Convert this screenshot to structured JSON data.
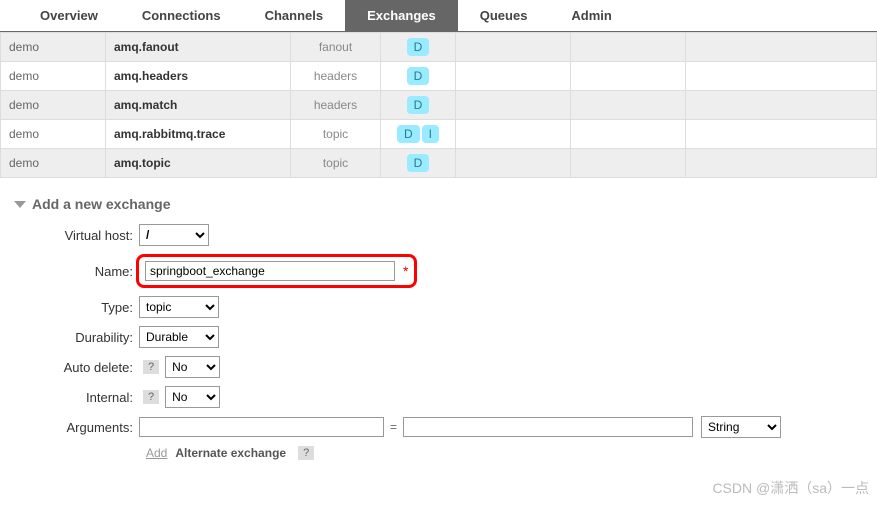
{
  "tabs": {
    "overview": "Overview",
    "connections": "Connections",
    "channels": "Channels",
    "exchanges": "Exchanges",
    "queues": "Queues",
    "admin": "Admin"
  },
  "table": {
    "rows": [
      {
        "vhost": "demo",
        "name": "amq.fanout",
        "type": "fanout",
        "badges": [
          "D"
        ]
      },
      {
        "vhost": "demo",
        "name": "amq.headers",
        "type": "headers",
        "badges": [
          "D"
        ]
      },
      {
        "vhost": "demo",
        "name": "amq.match",
        "type": "headers",
        "badges": [
          "D"
        ]
      },
      {
        "vhost": "demo",
        "name": "amq.rabbitmq.trace",
        "type": "topic",
        "badges": [
          "D",
          "I"
        ]
      },
      {
        "vhost": "demo",
        "name": "amq.topic",
        "type": "topic",
        "badges": [
          "D"
        ]
      }
    ]
  },
  "section": {
    "add_title": "Add a new exchange"
  },
  "form": {
    "labels": {
      "vhost": "Virtual host:",
      "name": "Name:",
      "type": "Type:",
      "durability": "Durability:",
      "autodelete": "Auto delete:",
      "internal": "Internal:",
      "arguments": "Arguments:"
    },
    "values": {
      "vhost": "/",
      "name": "springboot_exchange",
      "type": "topic",
      "durability": "Durable",
      "autodelete": "No",
      "internal": "No",
      "argkey": "",
      "argval": "",
      "argtype": "String"
    },
    "required_mark": "*",
    "help_mark": "?",
    "equals": "=",
    "add_text": "Add",
    "alternate_text": "Alternate exchange",
    "alternate_help": "?"
  },
  "watermark": "CSDN @潇洒（sa）一点"
}
